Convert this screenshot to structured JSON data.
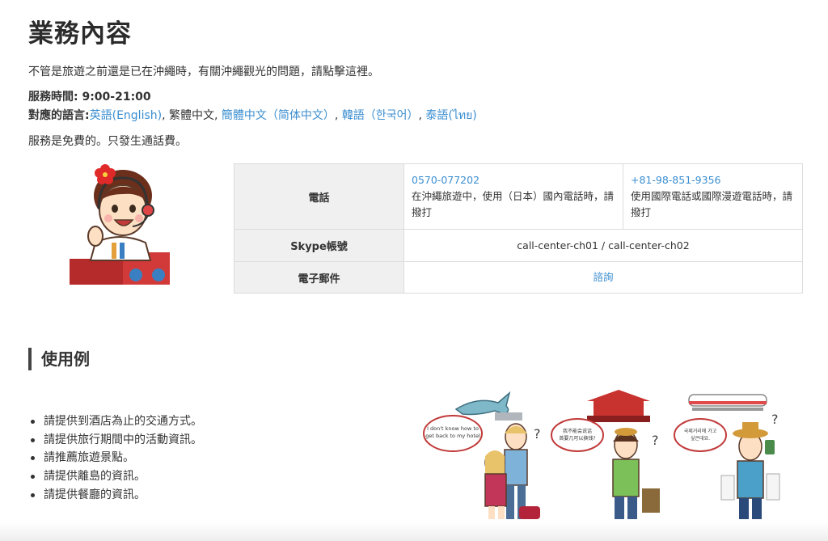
{
  "title": "業務內容",
  "intro": "不管是旅遊之前還是已在沖繩時，有關沖繩觀光的問題，請點擊這裡。",
  "hours": "服務時間: 9:00-21:00",
  "languages": {
    "label": "對應的語言:",
    "english": "英語(English)",
    "sep1": ", ",
    "traditional": "繁體中文",
    "sep2": ", ",
    "simplified": "簡體中文（简体中文）",
    "sep3": ", ",
    "korean": "韓語（한국어）",
    "sep4": ", ",
    "thai": "泰語(ไทย)"
  },
  "free_note": "服務是免費的。只發生通話費。",
  "contact_table": {
    "phone_header": "電話",
    "domestic_number": "0570-077202",
    "domestic_note": "在沖繩旅遊中，使用（日本）國內電話時，請撥打",
    "intl_number": "+81-98-851-9356",
    "intl_note": "使用國際電話或國際漫遊電話時，請撥打",
    "skype_header": "Skype帳號",
    "skype_value": "call-center-ch01 / call-center-ch02",
    "email_header": "電子郵件",
    "email_value": "諮詢"
  },
  "usage_section": {
    "title": "使用例",
    "items": [
      "請提供到酒店為止的交通方式。",
      "請提供旅行期間中的活動資訊。",
      "請推薦旅遊景點。",
      "請提供離島的資訊。",
      "請提供餐廳的資訊。"
    ]
  },
  "illustration": {
    "bubble1": "I don't know how to get back to my hotel",
    "bubble2": "我不能會说话 首要几可以换钱?",
    "bubble3": "국제거리에 가고 싶은데요."
  },
  "colors": {
    "link": "#3b8ed0",
    "table_header_bg": "#f0f0f0",
    "border": "#dcdcdc"
  }
}
